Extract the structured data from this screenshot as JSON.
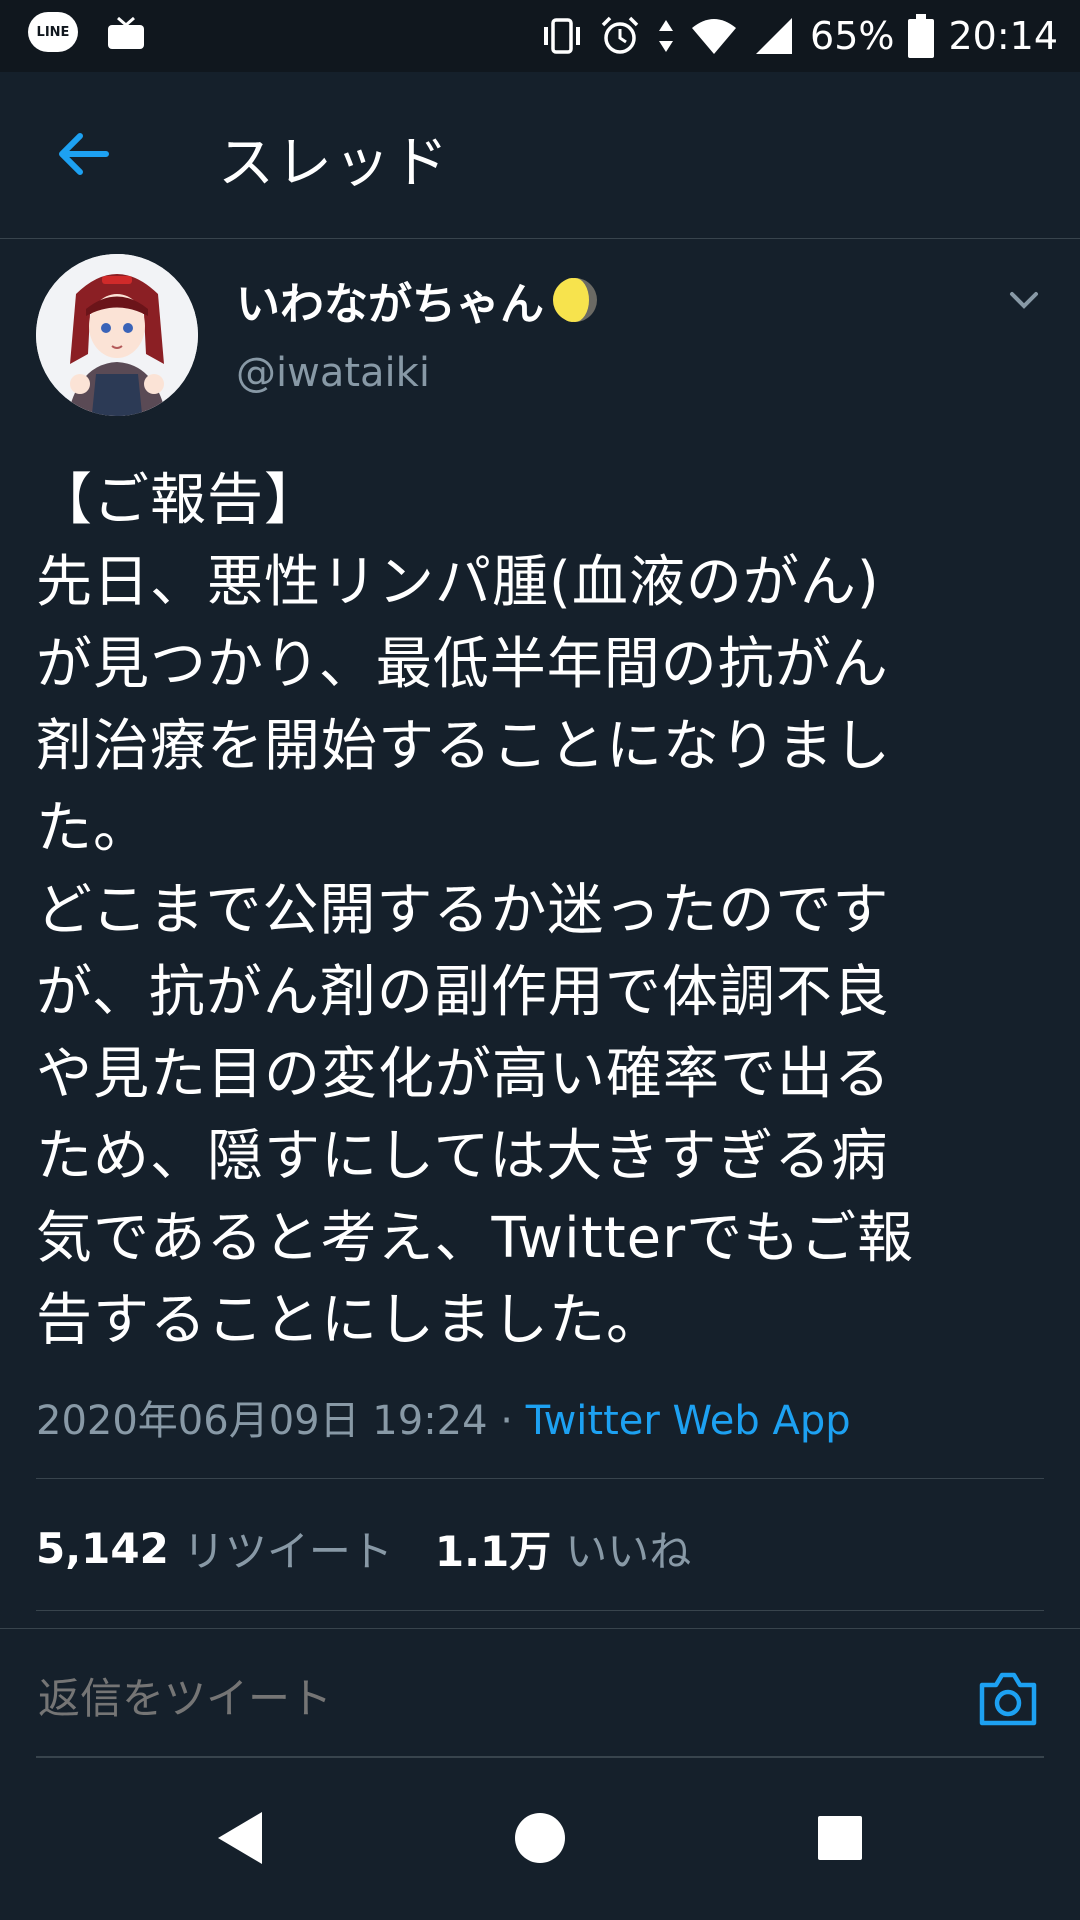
{
  "status_bar": {
    "left_icons": [
      "line-app-icon",
      "tv-icon"
    ],
    "right_icons": [
      "vibrate-icon",
      "alarm-icon",
      "data-arrows-icon",
      "wifi-icon",
      "signal-icon",
      "battery-icon"
    ],
    "battery": "65%",
    "time": "20:14"
  },
  "header": {
    "title": "スレッド",
    "back_icon": "back-arrow-icon"
  },
  "tweet": {
    "display_name": "いわながちゃん",
    "name_emoji": "moon-icon",
    "handle": "@iwataiki",
    "text": "【ご報告】\n先日、悪性リンパ腫(血液のがん)\nが見つかり、最低半年間の抗がん\n剤治療を開始することになりまし\nた。\nどこまで公開するか迷ったのです\nが、抗がん剤の副作用で体調不良\nや見た目の変化が高い確率で出る\nため、隠すにしては大きすぎる病\n気であると考え、Twitterでもご報\n告することにしました。",
    "datetime": "2020年06月09日 19:24",
    "separator": " · ",
    "source": "Twitter Web App"
  },
  "stats": {
    "retweets_count": "5,142",
    "retweets_label": "リツイート",
    "likes_count": "1.1万",
    "likes_label": "いいね"
  },
  "reply": {
    "placeholder": "返信をツイート",
    "camera_icon": "camera-icon"
  },
  "nav_bar": {
    "buttons": [
      "back-triangle-icon",
      "home-circle-icon",
      "recents-square-icon"
    ]
  },
  "colors": {
    "background": "#15202b",
    "status_bar": "#10171e",
    "accent": "#1da1f2",
    "secondary_text": "#8899a6",
    "divider": "#38444d"
  }
}
